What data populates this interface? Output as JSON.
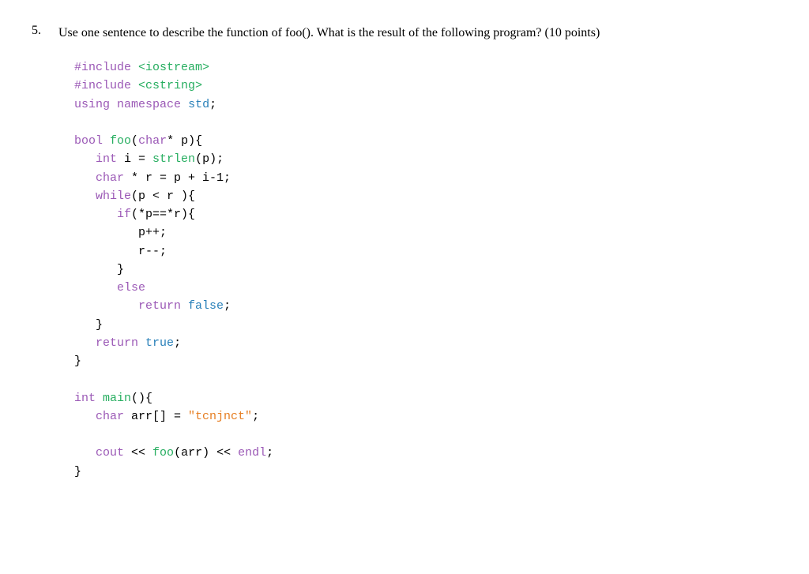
{
  "question": {
    "number": "5.",
    "text": "Use one sentence to describe the function of foo(). What is the result of the following program? (10 points)",
    "code": {
      "lines": [
        {
          "id": "l1",
          "content": "#include <iostream>"
        },
        {
          "id": "l2",
          "content": "#include <cstring>"
        },
        {
          "id": "l3",
          "content": "using namespace std;"
        },
        {
          "id": "l4",
          "content": ""
        },
        {
          "id": "l5",
          "content": "bool foo(char* p){"
        },
        {
          "id": "l6",
          "content": "  int i = strlen(p);"
        },
        {
          "id": "l7",
          "content": "  char * r = p + i-1;"
        },
        {
          "id": "l8",
          "content": "  while(p < r ){"
        },
        {
          "id": "l9",
          "content": "    if(*p==*r){"
        },
        {
          "id": "l10",
          "content": "      p++;"
        },
        {
          "id": "l11",
          "content": "      r--;"
        },
        {
          "id": "l12",
          "content": "    }"
        },
        {
          "id": "l13",
          "content": "    else"
        },
        {
          "id": "l14",
          "content": "      return false;"
        },
        {
          "id": "l15",
          "content": "  }"
        },
        {
          "id": "l16",
          "content": "  return true;"
        },
        {
          "id": "l17",
          "content": "}"
        },
        {
          "id": "l18",
          "content": ""
        },
        {
          "id": "l19",
          "content": "int main(){"
        },
        {
          "id": "l20",
          "content": "  char arr[] = \"tcnjnct\";"
        },
        {
          "id": "l21",
          "content": ""
        },
        {
          "id": "l22",
          "content": "  cout << foo(arr) << endl;"
        },
        {
          "id": "l23",
          "content": "}"
        }
      ]
    }
  }
}
